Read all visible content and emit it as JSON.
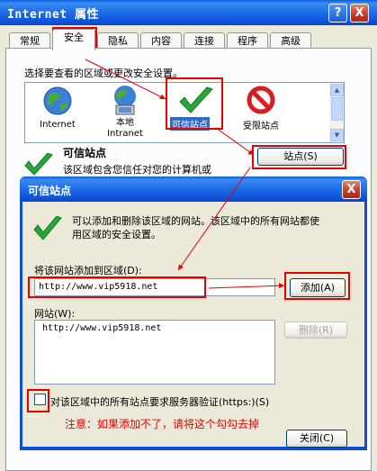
{
  "outer": {
    "title": "Internet 属性",
    "help_btn": "?",
    "close_btn": "X",
    "tabs": [
      {
        "label": "常规"
      },
      {
        "label": "安全"
      },
      {
        "label": "隐私"
      },
      {
        "label": "内容"
      },
      {
        "label": "连接"
      },
      {
        "label": "程序"
      },
      {
        "label": "高级"
      }
    ],
    "instruction": "选择要查看的区域或更改安全设置。",
    "zones": [
      {
        "label": "Internet",
        "icon": "globe-icon"
      },
      {
        "label": "本地\nIntranet",
        "icon": "local-intranet-icon"
      },
      {
        "label": "可信站点",
        "icon": "checkmark-icon"
      },
      {
        "label": "受限站点",
        "icon": "restricted-icon"
      }
    ],
    "zone_heading": "可信站点",
    "zone_desc": "该区域包含您信任对您的计算机或",
    "sites_button": "站点(S)"
  },
  "dialog": {
    "title": "可信站点",
    "close_btn": "X",
    "info": "可以添加和删除该区域的网站。该区域中的所有网站都使\n用区域的安全设置。",
    "add_label": "将该网站添加到区域(D):",
    "add_value": "http://www.vip5918.net",
    "add_button": "添加(A)",
    "websites_label": "网站(W):",
    "websites": [
      "http://www.vip5918.net"
    ],
    "remove_button": "删除(R)",
    "https_checkbox_label": "对该区域中的所有站点要求服务器验证(https:)(S)",
    "https_checked": false,
    "note": "注意：如果添加不了，请将这个勾勾去掉",
    "close_button": "关闭(C)"
  },
  "colors": {
    "accent_red": "#e60000",
    "titlebar_blue": "#0a5ee0",
    "note_red": "#e60000"
  }
}
